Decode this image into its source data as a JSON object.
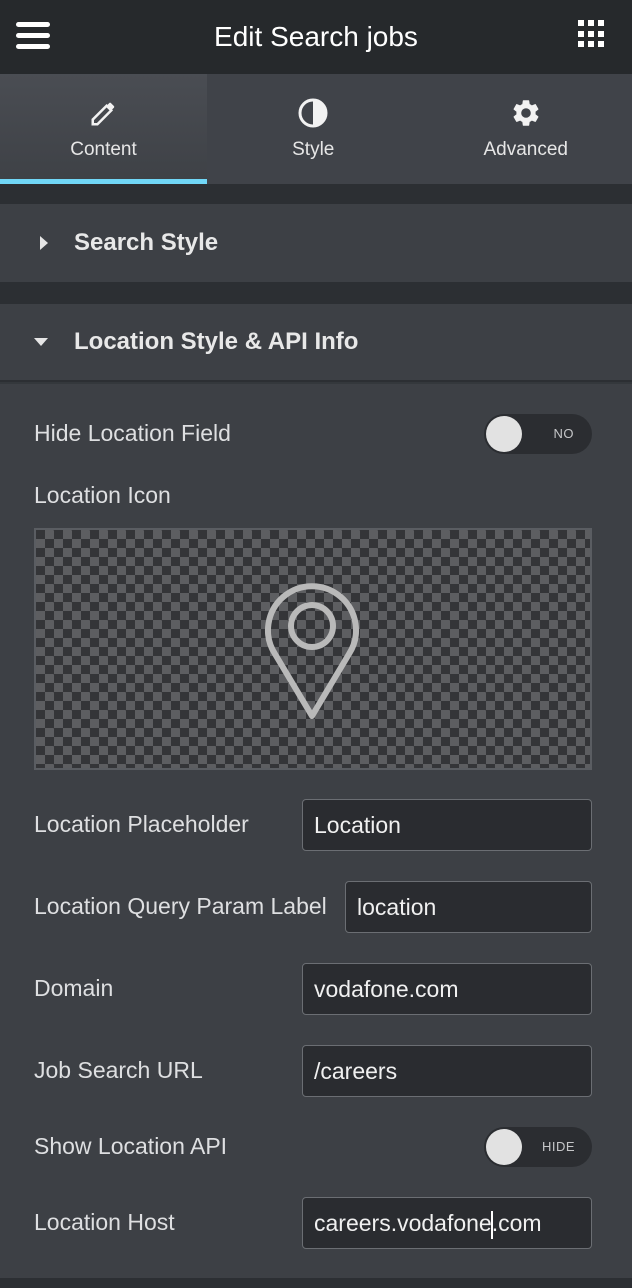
{
  "header": {
    "title": "Edit Search jobs",
    "menu_icon": "hamburger-menu-icon",
    "apps_icon": "grid-apps-icon"
  },
  "tabs": [
    {
      "label": "Content",
      "icon": "pencil-icon",
      "active": true
    },
    {
      "label": "Style",
      "icon": "half-circle-contrast-icon",
      "active": false
    },
    {
      "label": "Advanced",
      "icon": "gear-icon",
      "active": false
    }
  ],
  "sections": {
    "search_style": {
      "title": "Search Style",
      "expanded": false
    },
    "location_style": {
      "title": "Location Style & API Info",
      "expanded": true
    }
  },
  "controls": {
    "hide_location_field": {
      "label": "Hide Location Field",
      "state": "NO"
    },
    "location_icon": {
      "label": "Location Icon",
      "icon": "map-pin-icon"
    },
    "location_placeholder": {
      "label": "Location Placeholder",
      "value": "Location"
    },
    "location_query_param": {
      "label": "Location Query Param Label",
      "value": "location"
    },
    "domain": {
      "label": "Domain",
      "value": "vodafone.com"
    },
    "job_search_url": {
      "label": "Job Search URL",
      "value": "/careers"
    },
    "show_location_api": {
      "label": "Show Location API",
      "state": "HIDE"
    },
    "location_host": {
      "label": "Location Host",
      "value_before_cursor": "careers.vodafone",
      "value_after_cursor": ".com"
    }
  },
  "colors": {
    "accent": "#71d7f7",
    "header_bg": "#26292c",
    "panel_bg": "#3d4045"
  }
}
